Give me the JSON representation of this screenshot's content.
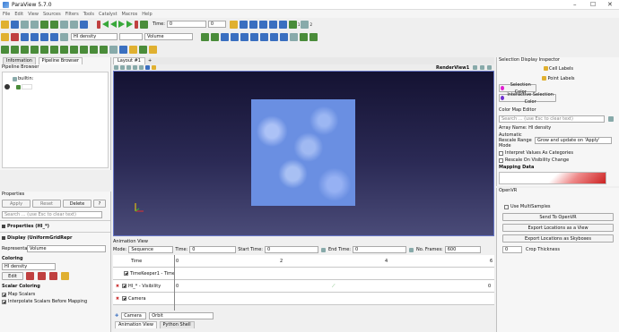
{
  "app": {
    "title": "ParaView 5.7.0"
  },
  "menu": [
    "File",
    "Edit",
    "View",
    "Sources",
    "Filters",
    "Tools",
    "Catalyst",
    "Macros",
    "Help"
  ],
  "toolbar": {
    "time_label": "Time:",
    "time_value": "0",
    "frame_value": "0",
    "array_select": "HI density",
    "representation_select": "Volume",
    "tick_1": "1",
    "tick_2": "2"
  },
  "pipeline_browser": {
    "info_tab": "Information",
    "title_tab": "Pipeline Browser",
    "header": "Pipeline Browser",
    "root": "builtin:"
  },
  "properties": {
    "header": "Properties",
    "apply": "Apply",
    "reset": "Reset",
    "delete": "Delete",
    "help": "?",
    "search_placeholder": "Search ... (use Esc to clear text)",
    "section_props": "Properties (HI_*)",
    "section_display": "Display (UniformGridRepr",
    "representation_label": "Representation",
    "representation_value": "Volume",
    "coloring_label": "Coloring",
    "coloring_value": "HI density",
    "edit": "Edit",
    "scalar_coloring": "Scalar Coloring",
    "map_scalars": "Map Scalars",
    "interpolate": "Interpolate Scalars Before Mapping"
  },
  "layout": {
    "tab": "Layout #1",
    "add_tab": "+",
    "view_name": "RenderView1"
  },
  "animation": {
    "header": "Animation View",
    "mode_label": "Mode:",
    "mode_value": "Sequence",
    "time_label": "Time:",
    "time_value": "0",
    "start_label": "Start Time:",
    "start_value": "0",
    "end_label": "End Time:",
    "end_value": "0",
    "frames_label": "No. Frames:",
    "frames_value": "600",
    "time_row": "Time",
    "tick_0": "0",
    "tick_2": "2",
    "tick_4": "4",
    "tick_end": "6",
    "keeper": "TimeKeeper1 - Time",
    "visibility": "HI_* - Visibility",
    "vis_start": "0",
    "vis_end": "0",
    "camera": "Camera",
    "camera_select": "Camera",
    "orbit_select": "Orbit",
    "tab_anim": "Animation View",
    "tab_python": "Python Shell"
  },
  "selection": {
    "header": "Selection Display Inspector",
    "cell_labels": "Cell Labels",
    "point_labels": "Point Labels",
    "selection_color": "Selection Color",
    "interactive_color": "Interactive Selection Color"
  },
  "colormap": {
    "header": "Color Map Editor",
    "search_placeholder": "Search ... (use Esc to clear text)",
    "array_name": "Array Name: HI density",
    "rescale_label": "Automatic Rescale Range Mode",
    "rescale_value": "Grow and update on 'Apply'",
    "interpret": "Interpret Values As Categories",
    "rescale_vis": "Rescale On Visibility Change",
    "mapping": "Mapping Data"
  },
  "openvr": {
    "header": "OpenVR",
    "multisamples": "Use MultiSamples",
    "send": "Send To OpenVR",
    "export_view": "Export Locations as a View",
    "export_skybox": "Export Locations as Skyboxes",
    "crop_value": "0",
    "crop_label": "Crop Thickness"
  }
}
